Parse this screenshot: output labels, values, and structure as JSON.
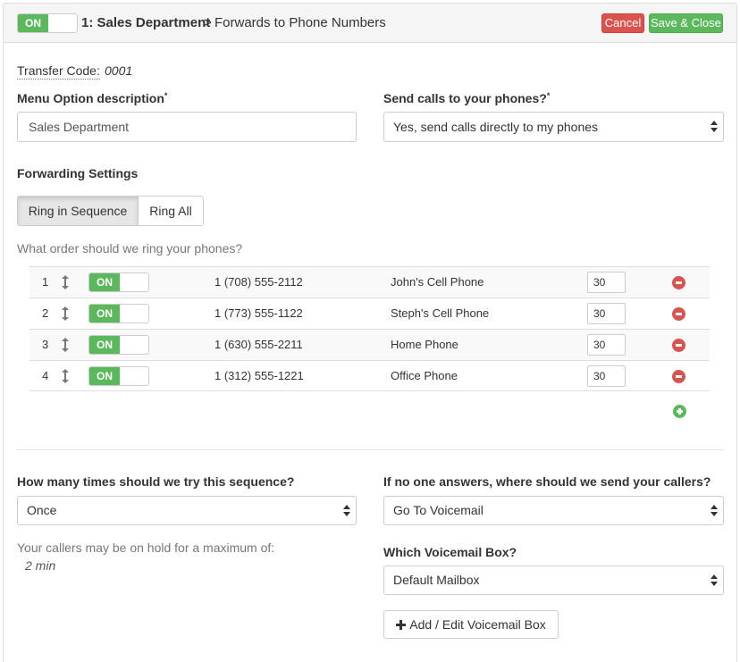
{
  "header": {
    "toggle_label": "ON",
    "title_bold": "1: Sales Department",
    "separator": ">",
    "title_rest": "Forwards to Phone Numbers",
    "cancel_label": "Cancel",
    "save_label": "Save & Close"
  },
  "transfer": {
    "label": "Transfer Code:",
    "value": "0001"
  },
  "menu_option": {
    "label": "Menu Option description",
    "required": "*",
    "value": "Sales Department"
  },
  "send_calls": {
    "label": "Send calls to your phones?",
    "required": "*",
    "value": "Yes, send calls directly to my phones"
  },
  "forwarding": {
    "heading": "Forwarding Settings",
    "modes": [
      "Ring in Sequence",
      "Ring All"
    ],
    "active_mode": "Ring in Sequence",
    "question": "What order should we ring your phones?"
  },
  "phones": [
    {
      "index": "1",
      "toggle": "ON",
      "number": "1 (708) 555-2112",
      "name": "John's Cell Phone",
      "seconds": "30"
    },
    {
      "index": "2",
      "toggle": "ON",
      "number": "1 (773) 555-1122",
      "name": "Steph's Cell Phone",
      "seconds": "30"
    },
    {
      "index": "3",
      "toggle": "ON",
      "number": "1 (630) 555-2211",
      "name": "Home Phone",
      "seconds": "30"
    },
    {
      "index": "4",
      "toggle": "ON",
      "number": "1 (312) 555-1221",
      "name": "Office Phone",
      "seconds": "30"
    }
  ],
  "tries": {
    "label": "How many times should we try this sequence?",
    "value": "Once"
  },
  "hold": {
    "text": "Your callers may be on hold for a maximum of:",
    "value": "2 min"
  },
  "no_answer": {
    "label": "If no one answers, where should we send your callers?",
    "value": "Go To Voicemail"
  },
  "voicemail": {
    "label": "Which Voicemail Box?",
    "value": "Default Mailbox",
    "button_label": "Add / Edit Voicemail Box"
  },
  "colors": {
    "success": "#5cb85c",
    "danger": "#d9534f",
    "border": "#cccccc"
  },
  "icons": {
    "row_sort": "sort-vertical-icon",
    "row_remove": "minus-circle-icon",
    "add_row": "plus-circle-icon",
    "select_caret": "up-down-caret-icon"
  }
}
